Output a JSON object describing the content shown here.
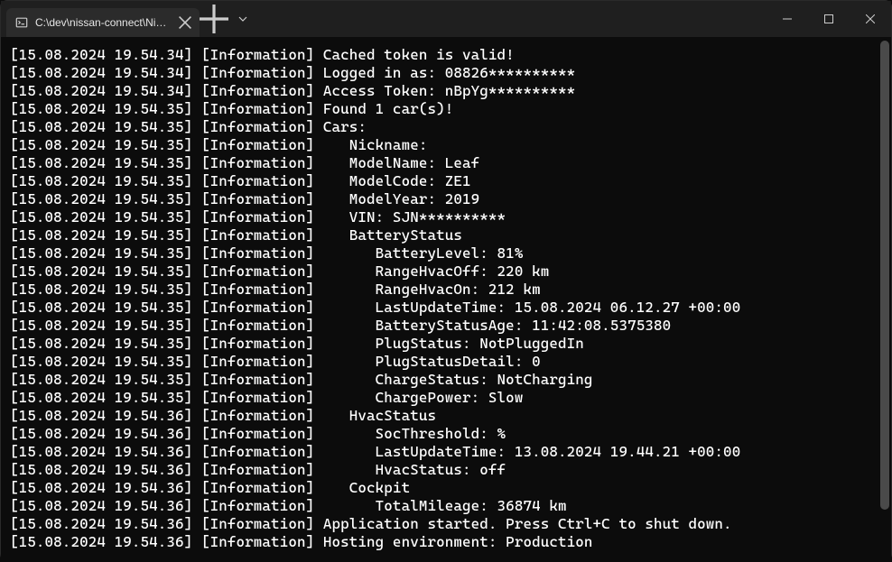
{
  "window": {
    "tab_title": "C:\\dev\\nissan-connect\\Nissan"
  },
  "logs": [
    {
      "ts": "[15.08.2024 19.54.34]",
      "lvl": "[Information]",
      "msg": "Cached token is valid!"
    },
    {
      "ts": "[15.08.2024 19.54.34]",
      "lvl": "[Information]",
      "msg": "Logged in as: 08826**********"
    },
    {
      "ts": "[15.08.2024 19.54.34]",
      "lvl": "[Information]",
      "msg": "Access Token: nBpYg**********"
    },
    {
      "ts": "[15.08.2024 19.54.35]",
      "lvl": "[Information]",
      "msg": "Found 1 car(s)!"
    },
    {
      "ts": "[15.08.2024 19.54.35]",
      "lvl": "[Information]",
      "msg": "Cars:"
    },
    {
      "ts": "[15.08.2024 19.54.35]",
      "lvl": "[Information]",
      "msg": "   Nickname:"
    },
    {
      "ts": "[15.08.2024 19.54.35]",
      "lvl": "[Information]",
      "msg": "   ModelName: Leaf"
    },
    {
      "ts": "[15.08.2024 19.54.35]",
      "lvl": "[Information]",
      "msg": "   ModelCode: ZE1"
    },
    {
      "ts": "[15.08.2024 19.54.35]",
      "lvl": "[Information]",
      "msg": "   ModelYear: 2019"
    },
    {
      "ts": "[15.08.2024 19.54.35]",
      "lvl": "[Information]",
      "msg": "   VIN: SJN**********"
    },
    {
      "ts": "[15.08.2024 19.54.35]",
      "lvl": "[Information]",
      "msg": "   BatteryStatus"
    },
    {
      "ts": "[15.08.2024 19.54.35]",
      "lvl": "[Information]",
      "msg": "      BatteryLevel: 81%"
    },
    {
      "ts": "[15.08.2024 19.54.35]",
      "lvl": "[Information]",
      "msg": "      RangeHvacOff: 220 km"
    },
    {
      "ts": "[15.08.2024 19.54.35]",
      "lvl": "[Information]",
      "msg": "      RangeHvacOn: 212 km"
    },
    {
      "ts": "[15.08.2024 19.54.35]",
      "lvl": "[Information]",
      "msg": "      LastUpdateTime: 15.08.2024 06.12.27 +00:00"
    },
    {
      "ts": "[15.08.2024 19.54.35]",
      "lvl": "[Information]",
      "msg": "      BatteryStatusAge: 11:42:08.5375380"
    },
    {
      "ts": "[15.08.2024 19.54.35]",
      "lvl": "[Information]",
      "msg": "      PlugStatus: NotPluggedIn"
    },
    {
      "ts": "[15.08.2024 19.54.35]",
      "lvl": "[Information]",
      "msg": "      PlugStatusDetail: 0"
    },
    {
      "ts": "[15.08.2024 19.54.35]",
      "lvl": "[Information]",
      "msg": "      ChargeStatus: NotCharging"
    },
    {
      "ts": "[15.08.2024 19.54.35]",
      "lvl": "[Information]",
      "msg": "      ChargePower: Slow"
    },
    {
      "ts": "[15.08.2024 19.54.36]",
      "lvl": "[Information]",
      "msg": "   HvacStatus"
    },
    {
      "ts": "[15.08.2024 19.54.36]",
      "lvl": "[Information]",
      "msg": "      SocThreshold: %"
    },
    {
      "ts": "[15.08.2024 19.54.36]",
      "lvl": "[Information]",
      "msg": "      LastUpdateTime: 13.08.2024 19.44.21 +00:00"
    },
    {
      "ts": "[15.08.2024 19.54.36]",
      "lvl": "[Information]",
      "msg": "      HvacStatus: off"
    },
    {
      "ts": "[15.08.2024 19.54.36]",
      "lvl": "[Information]",
      "msg": "   Cockpit"
    },
    {
      "ts": "[15.08.2024 19.54.36]",
      "lvl": "[Information]",
      "msg": "      TotalMileage: 36874 km"
    },
    {
      "ts": "[15.08.2024 19.54.36]",
      "lvl": "[Information]",
      "msg": "Application started. Press Ctrl+C to shut down."
    },
    {
      "ts": "[15.08.2024 19.54.36]",
      "lvl": "[Information]",
      "msg": "Hosting environment: Production"
    }
  ]
}
